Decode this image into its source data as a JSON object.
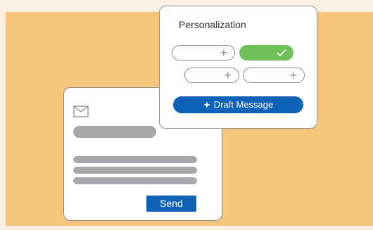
{
  "email_card": {
    "mail_icon": "envelope-icon",
    "send_label": "Send"
  },
  "personalization": {
    "title": "Personalization",
    "options": [
      {
        "state": "empty",
        "icon": "plus-icon"
      },
      {
        "state": "selected",
        "icon": "check-icon"
      },
      {
        "state": "empty",
        "icon": "plus-icon"
      },
      {
        "state": "empty",
        "icon": "plus-icon"
      }
    ],
    "draft_label": "Draft Message",
    "draft_icon": "sparkle-icon"
  },
  "colors": {
    "background": "#f5c47d",
    "accent_blue": "#0e63b8",
    "selected_green": "#6fbf59",
    "placeholder_gray": "#a6a8ab"
  }
}
